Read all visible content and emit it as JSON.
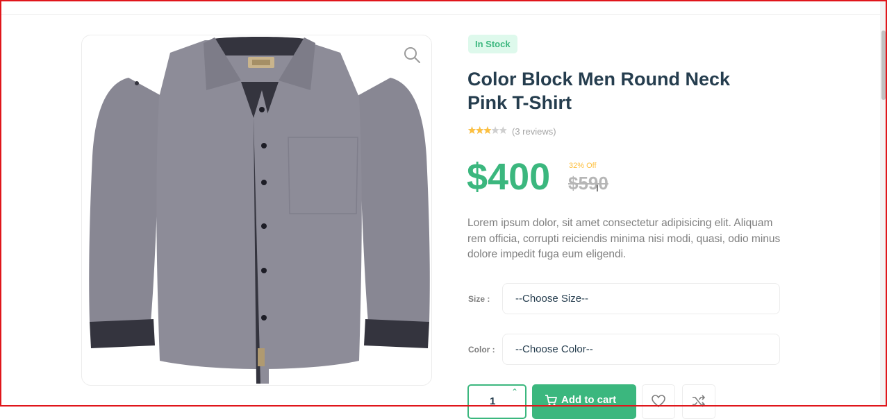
{
  "product": {
    "stock_badge": "In Stock",
    "title": "Color Block Men Round Neck Pink T-Shirt",
    "rating_fraction": 0.6,
    "reviews": "(3 reviews)",
    "price": "$400",
    "discount": "32% Off",
    "old_price": "$590",
    "description": "Lorem ipsum dolor, sit amet consectetur adipisicing elit. Aliquam rem officia, corrupti reiciendis minima nisi modi, quasi, odio minus dolore impedit fuga eum eligendi."
  },
  "options": {
    "size_label": "Size :",
    "size_value": "--Choose Size--",
    "color_label": "Color :",
    "color_value": "--Choose Color--"
  },
  "cart": {
    "quantity": "1",
    "add_label": "Add to cart"
  },
  "icons": {
    "zoom": "search-icon",
    "cart": "cart-icon",
    "wishlist": "heart-icon",
    "compare": "shuffle-icon",
    "quantity_up": "chevron-up-icon"
  },
  "colors": {
    "brand": "#3bb77e",
    "heading": "#253d4e",
    "badge_bg": "#def9ec",
    "star": "#fdc040",
    "frame": "#e0161b"
  }
}
